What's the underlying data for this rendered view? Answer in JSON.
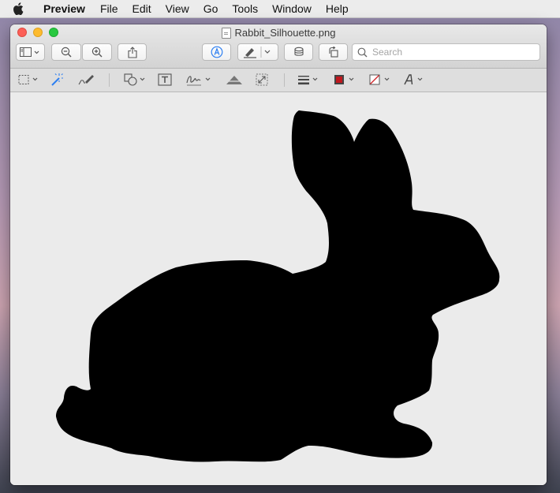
{
  "menubar": {
    "items": [
      "Preview",
      "File",
      "Edit",
      "View",
      "Go",
      "Tools",
      "Window",
      "Help"
    ]
  },
  "window": {
    "title": "Rabbit_Silhouette.png"
  },
  "toolbar": {
    "search_placeholder": "Search",
    "buttons": [
      "sidebar-icon",
      "zoom-out-icon",
      "zoom-in-icon",
      "share-icon",
      "markup-icon",
      "highlight-pen-icon",
      "stamp-icon",
      "rotate-icon"
    ]
  },
  "markup_toolbar": {
    "tools": [
      "rect-select-icon",
      "instant-alpha-icon",
      "sketch-icon",
      "shapes-icon",
      "text-box-icon",
      "sign-icon",
      "adjust-color-icon",
      "adjust-size-icon",
      "line-style-icon",
      "border-color-icon",
      "fill-color-icon",
      "text-style-icon"
    ],
    "colors": {
      "border": "#c0181e",
      "fill_slash": "#d0262a",
      "accent": "#2e7ff1"
    }
  },
  "image": {
    "subject": "rabbit-silhouette",
    "background": "#ebebeb",
    "fill": "#000000"
  }
}
